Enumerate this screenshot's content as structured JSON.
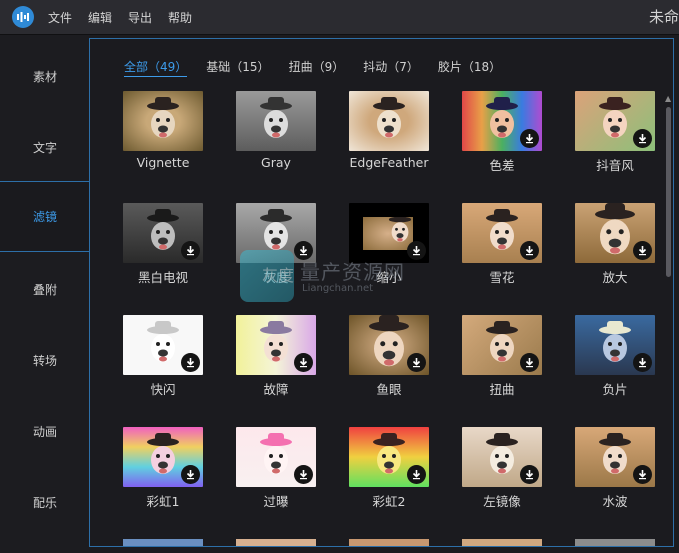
{
  "menubar": {
    "items": [
      "文件",
      "编辑",
      "导出",
      "帮助"
    ],
    "title": "未命"
  },
  "sidebar": {
    "items": [
      {
        "label": "素材",
        "active": false
      },
      {
        "label": "文字",
        "active": false
      },
      {
        "label": "滤镜",
        "active": true
      },
      {
        "label": "叠附",
        "active": false
      },
      {
        "label": "转场",
        "active": false
      },
      {
        "label": "动画",
        "active": false
      },
      {
        "label": "配乐",
        "active": false
      }
    ]
  },
  "tabs": [
    {
      "label": "全部（49）",
      "active": true
    },
    {
      "label": "基础（15）",
      "active": false
    },
    {
      "label": "扭曲（9）",
      "active": false
    },
    {
      "label": "抖动（7）",
      "active": false
    },
    {
      "label": "胶片（18）",
      "active": false
    }
  ],
  "filters": [
    {
      "label": "Vignette",
      "style": "vignette",
      "download": false
    },
    {
      "label": "Gray",
      "style": "gray",
      "download": false
    },
    {
      "label": "EdgeFeather",
      "style": "edgefeather",
      "download": false
    },
    {
      "label": "色差",
      "style": "chroma",
      "download": true
    },
    {
      "label": "抖音风",
      "style": "douyin",
      "download": true
    },
    {
      "label": "黑白电视",
      "style": "bwtv",
      "download": true
    },
    {
      "label": "灰度",
      "style": "grayscale",
      "download": true
    },
    {
      "label": "缩小",
      "style": "shrink",
      "download": true
    },
    {
      "label": "雪花",
      "style": "snow",
      "download": true
    },
    {
      "label": "放大",
      "style": "zoom",
      "download": true
    },
    {
      "label": "快闪",
      "style": "flash",
      "download": true
    },
    {
      "label": "故障",
      "style": "glitch",
      "download": true
    },
    {
      "label": "鱼眼",
      "style": "fisheye",
      "download": true
    },
    {
      "label": "扭曲",
      "style": "twist",
      "download": true
    },
    {
      "label": "负片",
      "style": "negative",
      "download": true
    },
    {
      "label": "彩虹1",
      "style": "rainbow1",
      "download": true
    },
    {
      "label": "过曝",
      "style": "overexpose",
      "download": true
    },
    {
      "label": "彩虹2",
      "style": "rainbow2",
      "download": true
    },
    {
      "label": "左镜像",
      "style": "mirror",
      "download": true
    },
    {
      "label": "水波",
      "style": "ripple",
      "download": true
    }
  ],
  "watermark": {
    "text1": "灰度",
    "text2": "量产资源网",
    "text3": "Liangchan.net"
  },
  "colors": {
    "accent": "#3d9be9",
    "panel_border": "#2d6fa8",
    "background": "#1b1b1f"
  }
}
